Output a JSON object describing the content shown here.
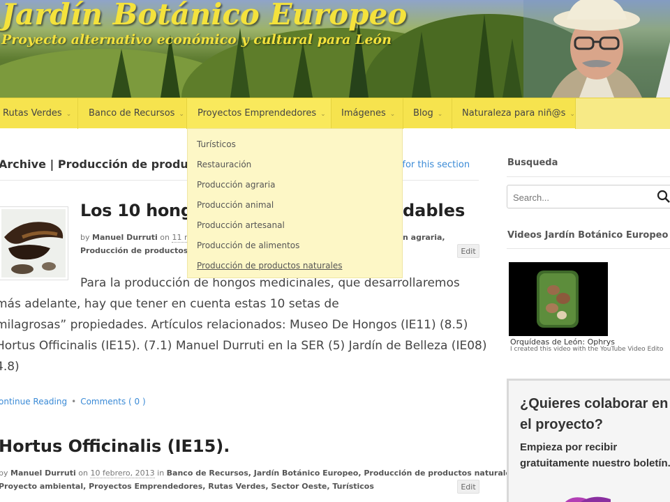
{
  "header": {
    "site_title": "Jardín Botánico Europeo",
    "tagline": "Proyecto alternativo económico y cultural para León"
  },
  "nav": {
    "items": [
      {
        "label": "Rutas Verdes"
      },
      {
        "label": "Banco de Recursos"
      },
      {
        "label": "Proyectos Emprendedores"
      },
      {
        "label": "Imágenes"
      },
      {
        "label": "Blog"
      },
      {
        "label": "Naturaleza para niñ@s"
      }
    ],
    "dropdown": [
      "Turísticos",
      "Restauración",
      "Producción agraria",
      "Producción animal",
      "Producción artesanal",
      "Producción de alimentos",
      "Producción de productos naturales"
    ]
  },
  "main": {
    "archive_title": "Archive | Producción de productos n",
    "rss_text": "d for this section",
    "post1": {
      "title_start": "Los 10 hongo",
      "title_end": "dables",
      "by": "by",
      "author": "Manuel Durruti",
      "on": "on",
      "date": "11 may",
      "meta_right": "n agraria,",
      "meta_line2": "Producción de productos natu",
      "edit": "Edit",
      "excerpt": [
        "Para la producción de hongos medicinales, que desarrollaremos",
        "más adelante, hay que tener en cuenta estas 10 setas de",
        "milagrosas”  propiedades. Artículos relacionados: Museo De Hongos (IE11) (8.5)",
        "Hortus Officinalis (IE15). (7.1) Manuel Durruti en la SER (5) Jardín de Belleza (IE08)",
        "4.8)"
      ],
      "continue": "ontinue Reading",
      "comments": "Comments ( 0 )"
    },
    "post2": {
      "title": "Hortus Officinalis (IE15).",
      "by": "by",
      "author": "Manuel Durruti",
      "on": "on",
      "date": "10 febrero, 2013",
      "in": "in",
      "categories_line1": "Banco de Recursos, Jardín Botánico Europeo, Producción de productos naturales,",
      "categories_line2": "Proyecto ambiental, Proyectos Emprendedores, Rutas Verdes, Sector Oeste, Turísticos",
      "edit": "Edit"
    }
  },
  "sidebar": {
    "search_title": "Busqueda",
    "search_placeholder": "Search...",
    "videos_title": "Videos Jardín Botánico Europeo",
    "video_caption": "Orquídeas de León: Ophrys",
    "video_sub": "I created this video with the YouTube Video Edito",
    "collab_title": "¿Quieres colaborar en el proyecto?",
    "collab_text": "Empieza por recibir gratuitamente nuestro boletín."
  },
  "colors": {
    "nav_bg": "#f6e34e",
    "dropdown_bg": "#fdf7c6",
    "title_yellow": "#f4e23c",
    "link_blue": "#3a8ad6"
  }
}
